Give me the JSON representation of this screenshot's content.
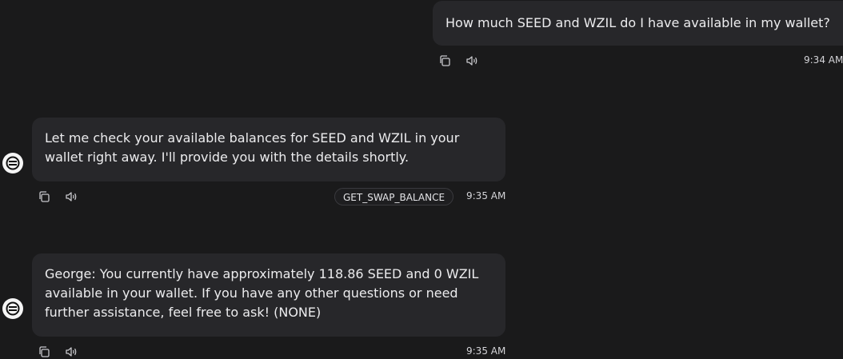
{
  "messages": [
    {
      "role": "user",
      "text": "How much SEED and WZIL do I have available in my wallet?",
      "time": "9:34 AM"
    },
    {
      "role": "agent",
      "text": "Let me check your available balances for SEED and WZIL in your wallet right away. I'll provide you with the details shortly.",
      "action": "GET_SWAP_BALANCE",
      "time": "9:35 AM"
    },
    {
      "role": "agent",
      "text": "George: You currently have approximately 118.86 SEED and 0 WZIL available in your wallet. If you have any other questions or need further assistance, feel free to ask! (NONE)",
      "time": "9:35 AM"
    }
  ],
  "icons": {
    "copy": "copy-icon",
    "speaker": "speaker-icon",
    "avatar": "eliza-logo-icon"
  },
  "colors": {
    "background": "#1a1a1b",
    "bubble": "#27272a",
    "text": "#ececee",
    "muted": "#d4d4d8"
  }
}
